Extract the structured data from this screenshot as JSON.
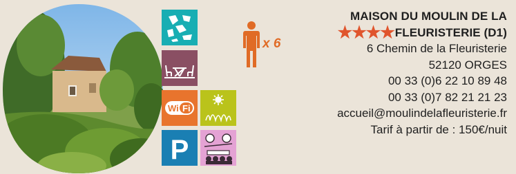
{
  "listing": {
    "name_line1": "MAISON DU MOULIN DE LA",
    "stars": "★★★★",
    "rating": 4,
    "name_line2": "FLEURISTERIE (D1)",
    "capacity": "x 6",
    "address_street": "6 Chemin de la Fleuristerie",
    "address_city": "52120 ORGES",
    "phone_1": "00 33 (0)6 22 10 89 48",
    "phone_2": "00 33 (0)7 82 21 21 23",
    "email": "accueil@moulindelafleuristerie.fr",
    "tariff": "Tarif à partir de : 150€/nuit"
  },
  "amenities": [
    {
      "icon": "hiking-icon",
      "color": "#18aeb3"
    },
    {
      "icon": "terrace-furniture-icon",
      "color": "#8a4f63"
    },
    {
      "icon": "wifi-icon",
      "label": "WiFi",
      "color": "#e8742d"
    },
    {
      "icon": "garden-icon",
      "color": "#bac31b"
    },
    {
      "icon": "parking-icon",
      "label": "P",
      "color": "#1a7fb3"
    },
    {
      "icon": "meeting-room-icon",
      "color": "#e4a2d4"
    }
  ],
  "colors": {
    "background": "#ebe4d9",
    "accent": "#e06b26",
    "star": "#e0552d",
    "text": "#1f1f1f"
  }
}
